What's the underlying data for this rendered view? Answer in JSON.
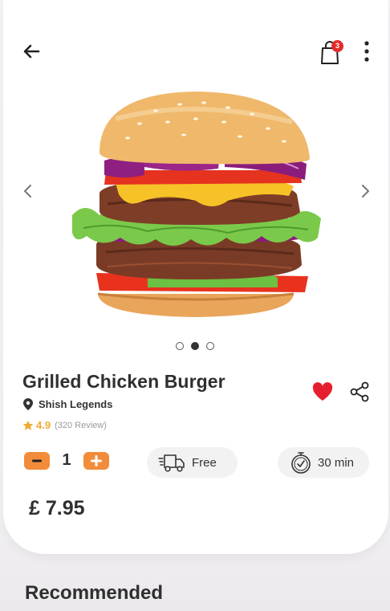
{
  "header": {
    "cart_count": "3"
  },
  "product": {
    "name": "Grilled Chicken Burger",
    "restaurant": "Shish Legends",
    "rating": "4.9",
    "reviews": "(320 Review)",
    "quantity": "1",
    "delivery": "Free",
    "prep_time": "30 min",
    "price": "£ 7.95",
    "favorited": true
  },
  "gallery": {
    "total_images": 3,
    "active_index": 1
  },
  "sections": {
    "recommended_title": "Recommended"
  },
  "colors": {
    "accent_orange": "#f28c3a",
    "favorite_red": "#e5202e",
    "rating_star": "#f2a92f",
    "badge_red": "#e52b2b"
  },
  "icons": {
    "back": "arrow-left-icon",
    "cart": "shopping-bag-icon",
    "more": "more-vertical-icon",
    "prev": "chevron-left-icon",
    "next": "chevron-right-icon",
    "location": "location-pin-icon",
    "star": "star-icon",
    "favorite": "heart-icon",
    "share": "share-icon",
    "minus": "minus-icon",
    "plus": "plus-icon",
    "delivery": "delivery-truck-icon",
    "timer": "stopwatch-icon"
  }
}
